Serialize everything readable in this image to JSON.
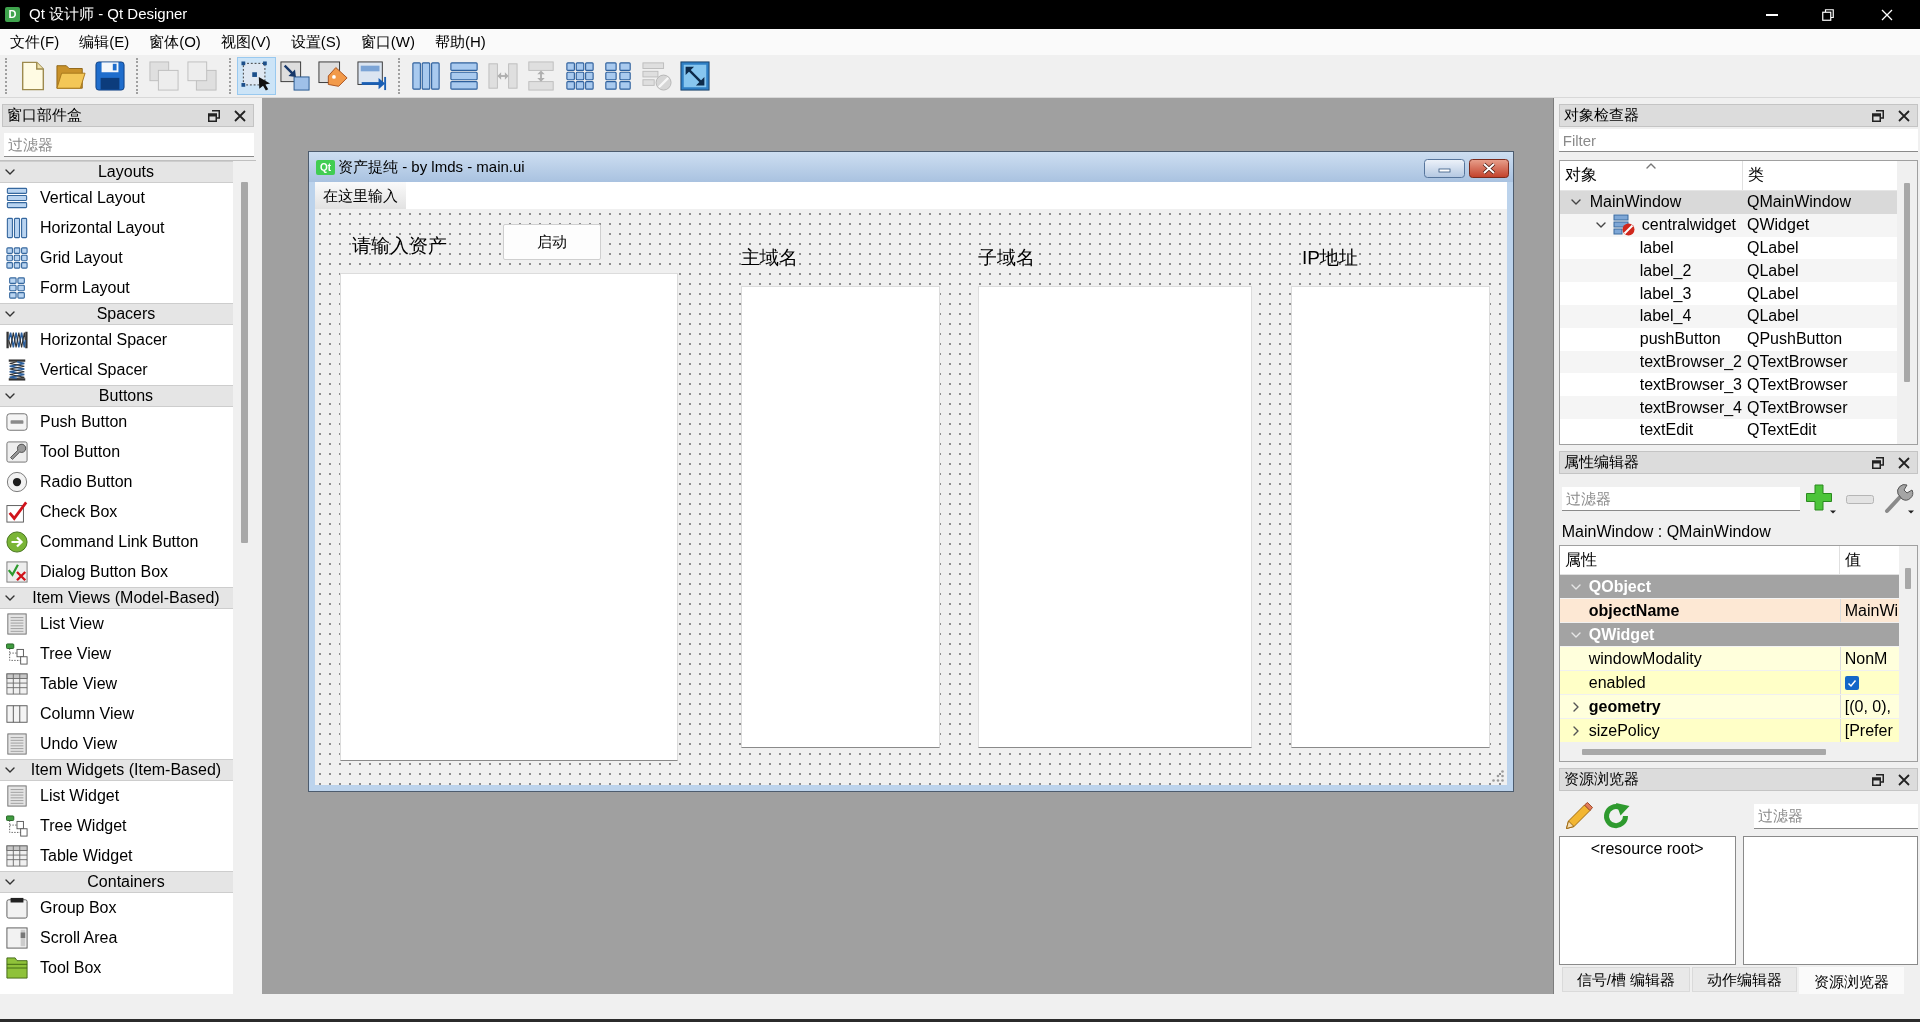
{
  "window": {
    "title": "Qt 设计师 - Qt Designer",
    "icon_text": "D"
  },
  "menu": [
    "文件(F)",
    "编辑(E)",
    "窗体(O)",
    "视图(V)",
    "设置(S)",
    "窗口(W)",
    "帮助(H)"
  ],
  "toolbar": [
    [
      {
        "kind": "new",
        "disabled": false
      },
      {
        "kind": "open",
        "disabled": false
      },
      {
        "kind": "save",
        "disabled": false
      }
    ],
    [
      {
        "kind": "front",
        "disabled": true
      },
      {
        "kind": "back",
        "disabled": true
      }
    ],
    [
      {
        "kind": "widgets",
        "disabled": false,
        "selected": true
      },
      {
        "kind": "signals",
        "disabled": false,
        "selected": false
      },
      {
        "kind": "buddies",
        "disabled": false,
        "selected": false
      },
      {
        "kind": "taborder",
        "disabled": false,
        "selected": false
      }
    ],
    [
      {
        "kind": "hbox",
        "disabled": false
      },
      {
        "kind": "vbox",
        "disabled": false
      },
      {
        "kind": "hsplit",
        "disabled": true
      },
      {
        "kind": "vsplit",
        "disabled": true
      },
      {
        "kind": "grid",
        "disabled": false
      },
      {
        "kind": "form",
        "disabled": false
      },
      {
        "kind": "break",
        "disabled": true
      },
      {
        "kind": "adjust",
        "disabled": false
      }
    ]
  ],
  "widget_box": {
    "title": "窗口部件盒",
    "filter_placeholder": "过滤器",
    "categories": [
      {
        "name": "Layouts",
        "expanded": true,
        "items": [
          {
            "label": "Vertical Layout",
            "kind": "vbox"
          },
          {
            "label": "Horizontal Layout",
            "kind": "hbox"
          },
          {
            "label": "Grid Layout",
            "kind": "grid"
          },
          {
            "label": "Form Layout",
            "kind": "form"
          }
        ]
      },
      {
        "name": "Spacers",
        "expanded": true,
        "items": [
          {
            "label": "Horizontal Spacer",
            "kind": "hspacer"
          },
          {
            "label": "Vertical Spacer",
            "kind": "vspacer"
          }
        ]
      },
      {
        "name": "Buttons",
        "expanded": true,
        "items": [
          {
            "label": "Push Button",
            "kind": "push"
          },
          {
            "label": "Tool Button",
            "kind": "tool"
          },
          {
            "label": "Radio Button",
            "kind": "radio"
          },
          {
            "label": "Check Box",
            "kind": "check"
          },
          {
            "label": "Command Link Button",
            "kind": "commandlink"
          },
          {
            "label": "Dialog Button Box",
            "kind": "buttonbox"
          }
        ]
      },
      {
        "name": "Item Views (Model-Based)",
        "expanded": true,
        "items": [
          {
            "label": "List View",
            "kind": "list"
          },
          {
            "label": "Tree View",
            "kind": "tree"
          },
          {
            "label": "Table View",
            "kind": "table"
          },
          {
            "label": "Column View",
            "kind": "column"
          },
          {
            "label": "Undo View",
            "kind": "list"
          }
        ]
      },
      {
        "name": "Item Widgets (Item-Based)",
        "expanded": true,
        "items": [
          {
            "label": "List Widget",
            "kind": "list"
          },
          {
            "label": "Tree Widget",
            "kind": "tree"
          },
          {
            "label": "Table Widget",
            "kind": "table"
          }
        ]
      },
      {
        "name": "Containers",
        "expanded": true,
        "items": [
          {
            "label": "Group Box",
            "kind": "groupbox"
          },
          {
            "label": "Scroll Area",
            "kind": "scroll"
          },
          {
            "label": "Tool Box",
            "kind": "toolbox"
          }
        ]
      }
    ]
  },
  "form": {
    "title": "资产提纯 - by lmds - main.ui",
    "icon_text": "Qt",
    "menu_entry": "在这里输入",
    "columns": [
      {
        "label": "请输入资产",
        "button": "启动"
      },
      {
        "label": "主域名"
      },
      {
        "label": "子域名"
      },
      {
        "label": "IP地址"
      }
    ]
  },
  "object_inspector": {
    "title": "对象检查器",
    "filter_placeholder": "Filter",
    "columns": [
      {
        "label": "对象",
        "sorted": true
      },
      {
        "label": "类",
        "sorted": false
      }
    ],
    "tree": [
      {
        "name": "MainWindow",
        "class": "QMainWindow",
        "selected": true,
        "expanded": true,
        "no_layout": false,
        "children": [
          {
            "name": "centralwidget",
            "class": "QWidget",
            "selected": false,
            "expanded": true,
            "no_layout": true,
            "children": [
              {
                "name": "label",
                "class": "QLabel",
                "selected": false
              },
              {
                "name": "label_2",
                "class": "QLabel",
                "selected": false
              },
              {
                "name": "label_3",
                "class": "QLabel",
                "selected": false
              },
              {
                "name": "label_4",
                "class": "QLabel",
                "selected": false
              },
              {
                "name": "pushButton",
                "class": "QPushButton",
                "selected": false
              },
              {
                "name": "textBrowser_2",
                "class": "QTextBrowser",
                "selected": false
              },
              {
                "name": "textBrowser_3",
                "class": "QTextBrowser",
                "selected": false
              },
              {
                "name": "textBrowser_4",
                "class": "QTextBrowser",
                "selected": false
              },
              {
                "name": "textEdit",
                "class": "QTextEdit",
                "selected": false
              }
            ]
          }
        ]
      }
    ]
  },
  "property_editor": {
    "title": "属性编辑器",
    "filter_placeholder": "过滤器",
    "object": "MainWindow : QMainWindow",
    "columns": [
      "属性",
      "值"
    ],
    "groups": [
      {
        "name": "QObject",
        "expanded": true,
        "color": "#fde8d4",
        "properties": [
          {
            "name": "objectName",
            "kind": "text",
            "value": "MainWi",
            "changed": true,
            "expandable": false
          }
        ]
      },
      {
        "name": "QWidget",
        "expanded": true,
        "color": "#ffffdc",
        "properties": [
          {
            "name": "windowModality",
            "kind": "text",
            "value": "NonM",
            "changed": false,
            "expandable": false
          },
          {
            "name": "enabled",
            "kind": "check",
            "checked": true,
            "changed": false,
            "expandable": false
          },
          {
            "name": "geometry",
            "kind": "text",
            "value": "[(0, 0),",
            "changed": true,
            "expandable": true
          },
          {
            "name": "sizePolicy",
            "kind": "text",
            "value": "[Prefer",
            "changed": false,
            "expandable": true
          }
        ]
      }
    ]
  },
  "resource_browser": {
    "title": "资源浏览器",
    "filter_placeholder": "过滤器",
    "root": "<resource root>",
    "tabs": [
      {
        "label": "信号/槽 编辑器",
        "selected": false
      },
      {
        "label": "动作编辑器",
        "selected": false
      },
      {
        "label": "资源浏览器",
        "selected": true
      }
    ]
  }
}
